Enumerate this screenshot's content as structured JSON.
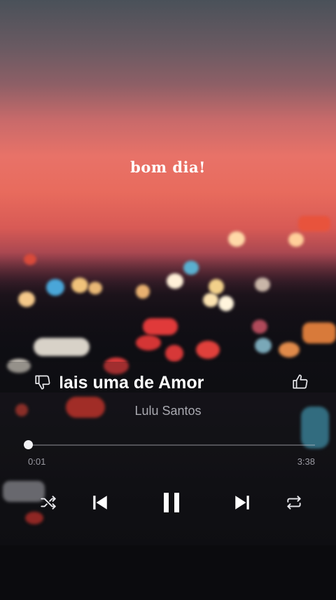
{
  "background": {
    "greeting": "bom dia!"
  },
  "player": {
    "title": "Mais uma de Amor",
    "artist": "Lulu Santos",
    "elapsed": "0:01",
    "duration": "3:38",
    "progress": 0.005,
    "state": "playing"
  },
  "icons": {
    "dislike": "thumbs-down-icon",
    "like": "thumbs-up-icon",
    "shuffle": "shuffle-icon",
    "previous": "previous-icon",
    "pause": "pause-icon",
    "next": "next-icon",
    "repeat": "repeat-icon"
  },
  "colors": {
    "sky_top": "#4a5159",
    "sky_glow": "#e87268",
    "text_primary": "#ffffff",
    "text_secondary": "#a9a9b0"
  }
}
